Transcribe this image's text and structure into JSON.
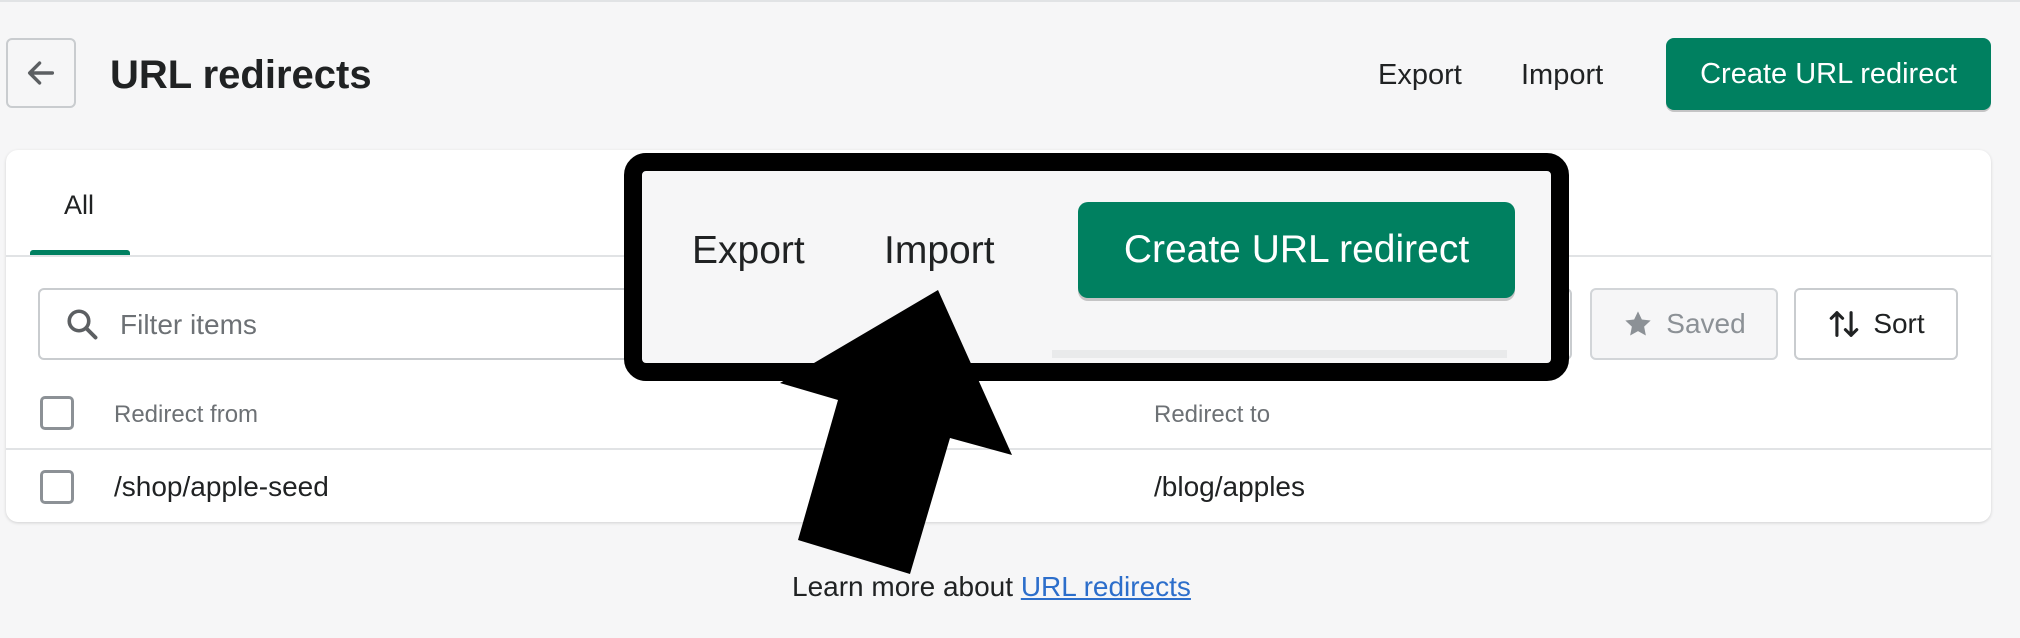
{
  "header": {
    "title": "URL redirects",
    "export_label": "Export",
    "import_label": "Import",
    "create_label": "Create URL redirect"
  },
  "tabs": [
    {
      "label": "All",
      "selected": true
    }
  ],
  "filters": {
    "search_placeholder": "Filter items",
    "saved_label": "Saved",
    "sort_label": "Sort"
  },
  "table": {
    "columns": [
      "Redirect from",
      "Redirect to"
    ],
    "rows": [
      {
        "from": "/shop/apple-seed",
        "to": "/blog/apples"
      }
    ]
  },
  "footer": {
    "prefix": "Learn more about ",
    "link_label": "URL redirects"
  },
  "zoom_callout": {
    "export_label": "Export",
    "import_label": "Import",
    "create_label": "Create URL redirect"
  },
  "colors": {
    "primary": "#008060",
    "link": "#2c6ecb",
    "background": "#f6f6f7"
  }
}
